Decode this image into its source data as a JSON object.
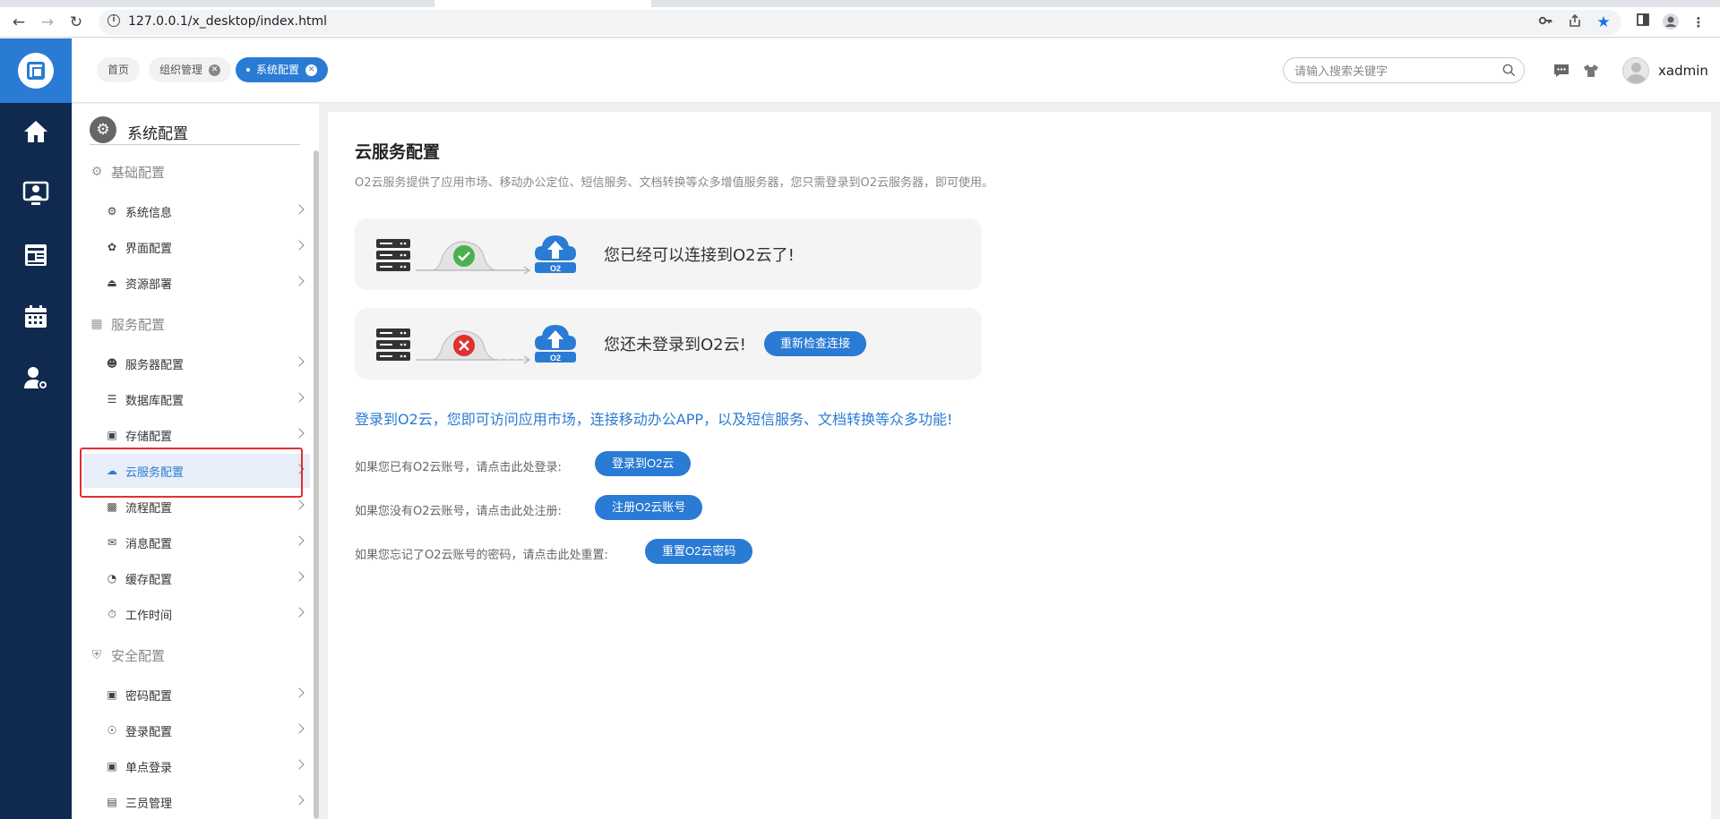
{
  "browser": {
    "url": "127.0.0.1/x_desktop/index.html"
  },
  "header": {
    "tabs": [
      {
        "label": "首页"
      },
      {
        "label": "组织管理"
      },
      {
        "label": "系统配置"
      }
    ],
    "search_placeholder": "请输入搜索关键字",
    "username": "xadmin"
  },
  "sidebar": {
    "title": "系统配置",
    "groups": [
      {
        "label": "基础配置",
        "items": [
          {
            "label": "系统信息",
            "icon": "gear-icon"
          },
          {
            "label": "界面配置",
            "icon": "palette-icon"
          },
          {
            "label": "资源部署",
            "icon": "deploy-icon"
          }
        ]
      },
      {
        "label": "服务配置",
        "items": [
          {
            "label": "服务器配置",
            "icon": "server-user-icon"
          },
          {
            "label": "数据库配置",
            "icon": "database-icon"
          },
          {
            "label": "存储配置",
            "icon": "storage-icon"
          },
          {
            "label": "云服务配置",
            "icon": "cloud-icon"
          },
          {
            "label": "流程配置",
            "icon": "flow-icon"
          },
          {
            "label": "消息配置",
            "icon": "message-icon"
          },
          {
            "label": "缓存配置",
            "icon": "pie-icon"
          },
          {
            "label": "工作时间",
            "icon": "timer-icon"
          }
        ]
      },
      {
        "label": "安全配置",
        "items": [
          {
            "label": "密码配置",
            "icon": "lock-icon"
          },
          {
            "label": "登录配置",
            "icon": "login-icon"
          },
          {
            "label": "单点登录",
            "icon": "sso-icon"
          },
          {
            "label": "三员管理",
            "icon": "doc-icon"
          }
        ]
      }
    ]
  },
  "main": {
    "title": "云服务配置",
    "description": "O2云服务提供了应用市场、移动办公定位、短信服务、文档转换等众多增值服务器，您只需登录到O2云服务器，即可使用。",
    "status_connected": "您已经可以连接到O2云了!",
    "status_not_logged": "您还未登录到O2云!",
    "retry_button": "重新检查连接",
    "cloud_label": "O2",
    "promo": "登录到O2云，您即可访问应用市场，连接移动办公APP，以及短信服务、文档转换等众多功能!",
    "rows": [
      {
        "text": "如果您已有O2云账号，请点击此处登录:",
        "button": "登录到O2云"
      },
      {
        "text": "如果您没有O2云账号，请点击此处注册:",
        "button": "注册O2云账号"
      },
      {
        "text": "如果您忘记了O2云账号的密码，请点击此处重置:",
        "button": "重置O2云密码"
      }
    ]
  },
  "colors": {
    "primary": "#2a7bd4",
    "rail": "#102a4f",
    "success": "#4caf50",
    "danger": "#e03030"
  }
}
